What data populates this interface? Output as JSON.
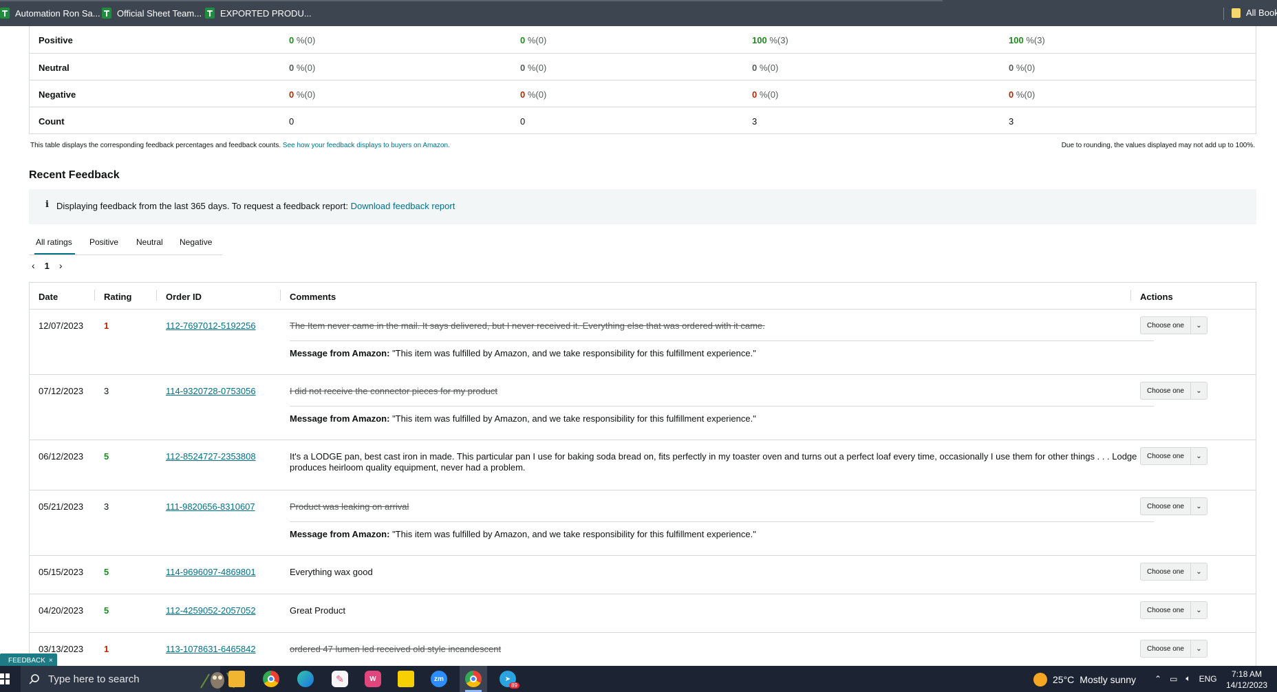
{
  "bookmarks": {
    "items": [
      {
        "label": "Automation Ron Sa..."
      },
      {
        "label": "Official Sheet Team..."
      },
      {
        "label": "EXPORTED PRODU..."
      }
    ],
    "all_bookmarks": "All Bookmarks"
  },
  "summary_table": {
    "rows": [
      {
        "label": "Positive",
        "cells": [
          {
            "pct": "0",
            "rest": " %(0)"
          },
          {
            "pct": "0",
            "rest": " %(0)"
          },
          {
            "pct": "100",
            "rest": " %(3)"
          },
          {
            "pct": "100",
            "rest": " %(3)"
          }
        ]
      },
      {
        "label": "Neutral",
        "cells": [
          {
            "pct": "0",
            "rest": " %(0)"
          },
          {
            "pct": "0",
            "rest": " %(0)"
          },
          {
            "pct": "0",
            "rest": " %(0)"
          },
          {
            "pct": "0",
            "rest": " %(0)"
          }
        ]
      },
      {
        "label": "Negative",
        "cells": [
          {
            "pct": "0",
            "rest": " %(0)"
          },
          {
            "pct": "0",
            "rest": " %(0)"
          },
          {
            "pct": "0",
            "rest": " %(0)"
          },
          {
            "pct": "0",
            "rest": " %(0)"
          }
        ]
      },
      {
        "label": "Count",
        "cells": [
          {
            "pct": "",
            "rest": "0"
          },
          {
            "pct": "",
            "rest": "0"
          },
          {
            "pct": "",
            "rest": "3"
          },
          {
            "pct": "",
            "rest": "3"
          }
        ]
      }
    ],
    "note_left": "This table displays the corresponding feedback percentages and feedback counts.",
    "note_left_link": "See how your feedback displays to buyers on Amazon.",
    "note_right": "Due to rounding, the values displayed may not add up to 100%."
  },
  "recent": {
    "title": "Recent Feedback",
    "info_icon": "i",
    "info_text": "Displaying feedback from the last 365 days. To request a feedback report:",
    "info_link": "Download feedback report",
    "tabs": [
      "All ratings",
      "Positive",
      "Neutral",
      "Negative"
    ],
    "pager": {
      "prev": "‹",
      "page": "1",
      "next": "›"
    }
  },
  "feedback_table": {
    "headers": {
      "date": "Date",
      "rating": "Rating",
      "order_id": "Order ID",
      "comments": "Comments",
      "actions": "Actions"
    },
    "dropdown_label": "Choose one",
    "amazon_msg_label": "Message from Amazon:",
    "amazon_msg_text": "\"This item was fulfilled by Amazon, and we take responsibility for this fulfillment experience.\"",
    "rows": [
      {
        "date": "12/07/2023",
        "rating": "1",
        "order_id": "112-7697012-5192256",
        "comment": "The Item never came in the mail. It says delivered, but I never received it. Everything else that was ordered with it came."
      },
      {
        "date": "07/12/2023",
        "rating": "3",
        "order_id": "114-9320728-0753056",
        "comment": "I did not receive the connector pieces for my product"
      },
      {
        "date": "06/12/2023",
        "rating": "5",
        "order_id": "112-8524727-2353808",
        "comment": "It's a LODGE pan, best cast iron in made. This particular pan I use for baking soda bread on, fits perfectly in my toaster oven and turns out a perfect loaf every time, occasionally I use them for other things . . . Lodge produces heirloom quality equipment, never had a problem."
      },
      {
        "date": "05/21/2023",
        "rating": "3",
        "order_id": "111-9820656-8310607",
        "comment": "Product was leaking on arrival"
      },
      {
        "date": "05/15/2023",
        "rating": "5",
        "order_id": "114-9696097-4869801",
        "comment": "Everything wax good"
      },
      {
        "date": "04/20/2023",
        "rating": "5",
        "order_id": "112-4259052-2057052",
        "comment": "Great Product"
      },
      {
        "date": "03/13/2023",
        "rating": "1",
        "order_id": "113-1078631-6465842",
        "comment": "ordered 47 lumen led received old style incandescent"
      }
    ]
  },
  "feedback_tab": {
    "label": "FEEDBACK",
    "close": "×"
  },
  "taskbar": {
    "search_placeholder": "Type here to search",
    "apps": [
      "file-explorer",
      "chrome",
      "edge",
      "paint",
      "wps",
      "sticky-notes",
      "zoom",
      "chrome-profile",
      "telegram"
    ],
    "weather_temp": "25°C",
    "weather_desc": "Mostly sunny",
    "lang": "ENG",
    "time": "7:18 AM",
    "date": "14/12/2023",
    "telegram_badge": "89"
  }
}
